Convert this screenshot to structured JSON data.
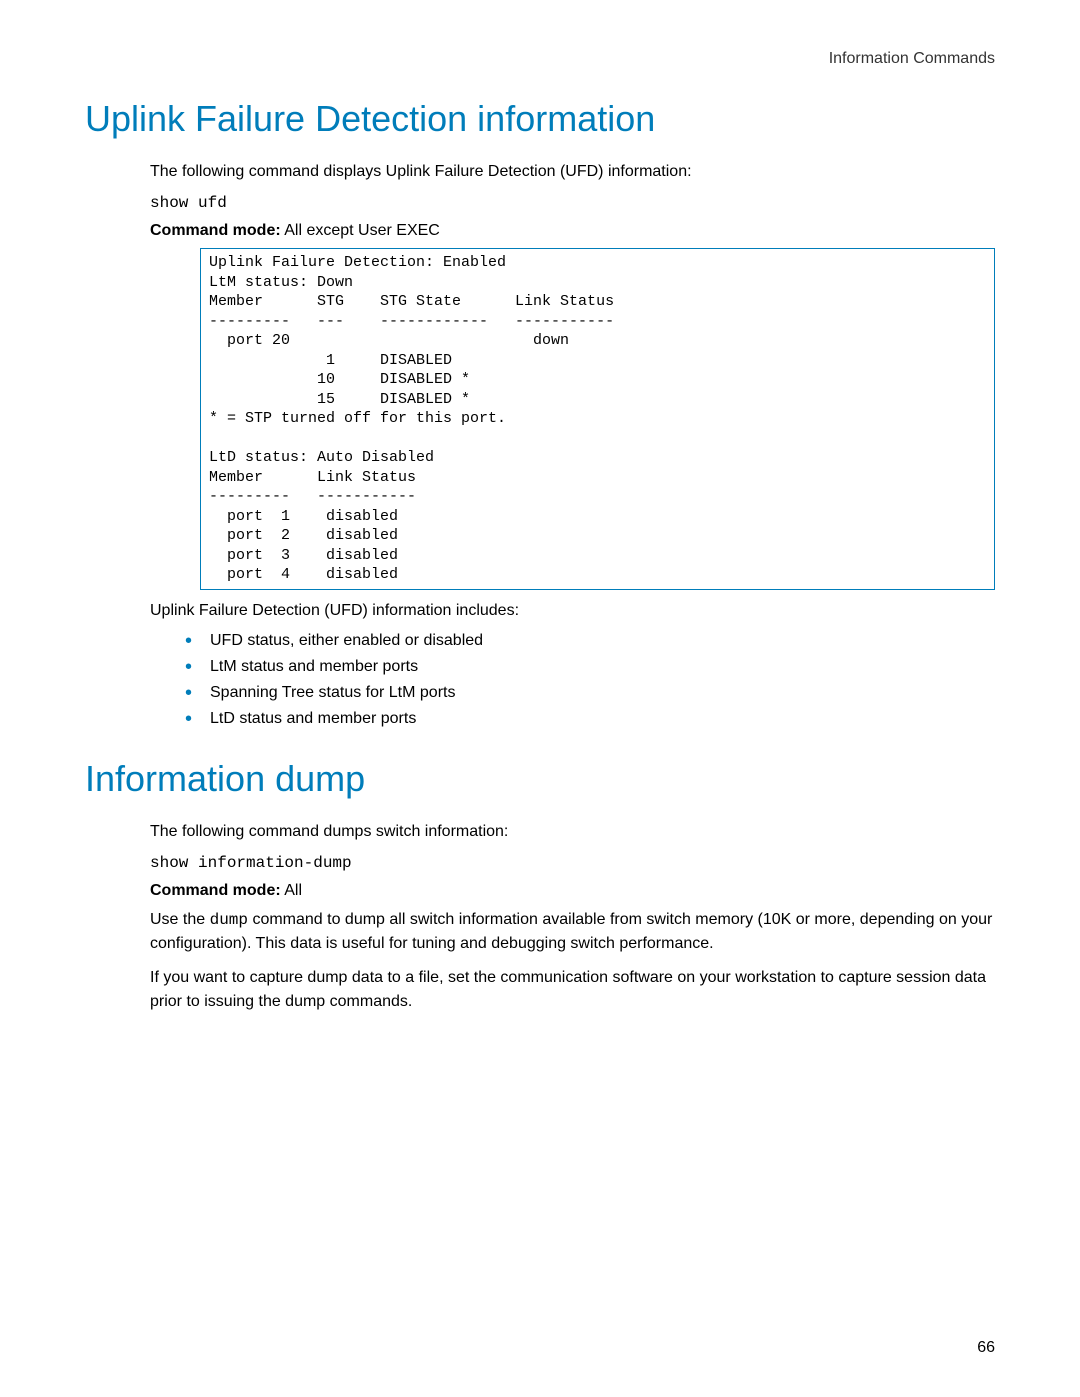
{
  "header": {
    "label": "Information Commands"
  },
  "section1": {
    "title": "Uplink Failure Detection information",
    "intro": "The following command displays Uplink Failure Detection (UFD) information:",
    "command": "show ufd",
    "mode_label": "Command mode:",
    "mode_value": " All except User EXEC",
    "code": "Uplink Failure Detection: Enabled\nLtM status: Down\nMember      STG    STG State      Link Status\n---------   ---    ------------   -----------\n  port 20                           down\n             1     DISABLED\n            10     DISABLED *\n            15     DISABLED *\n* = STP turned off for this port.\n\nLtD status: Auto Disabled\nMember      Link Status\n---------   -----------\n  port  1    disabled\n  port  2    disabled\n  port  3    disabled\n  port  4    disabled",
    "includes_intro": "Uplink Failure Detection (UFD) information includes:",
    "bullets": [
      "UFD status, either enabled or disabled",
      "LtM status and member ports",
      "Spanning Tree status for LtM ports",
      "LtD status and member ports"
    ]
  },
  "section2": {
    "title": "Information dump",
    "intro": "The following command dumps switch information:",
    "command": "show information-dump",
    "mode_label": "Command mode:",
    "mode_value": " All",
    "para1_pre": "Use the ",
    "para1_code": "dump",
    "para1_post": " command to dump all switch information available from switch memory (10K or more, depending on your configuration). This data is useful for tuning and debugging switch performance.",
    "para2": "If you want to capture dump data to a file, set the communication software on your workstation to capture session data prior to issuing the dump commands."
  },
  "page_number": "66"
}
